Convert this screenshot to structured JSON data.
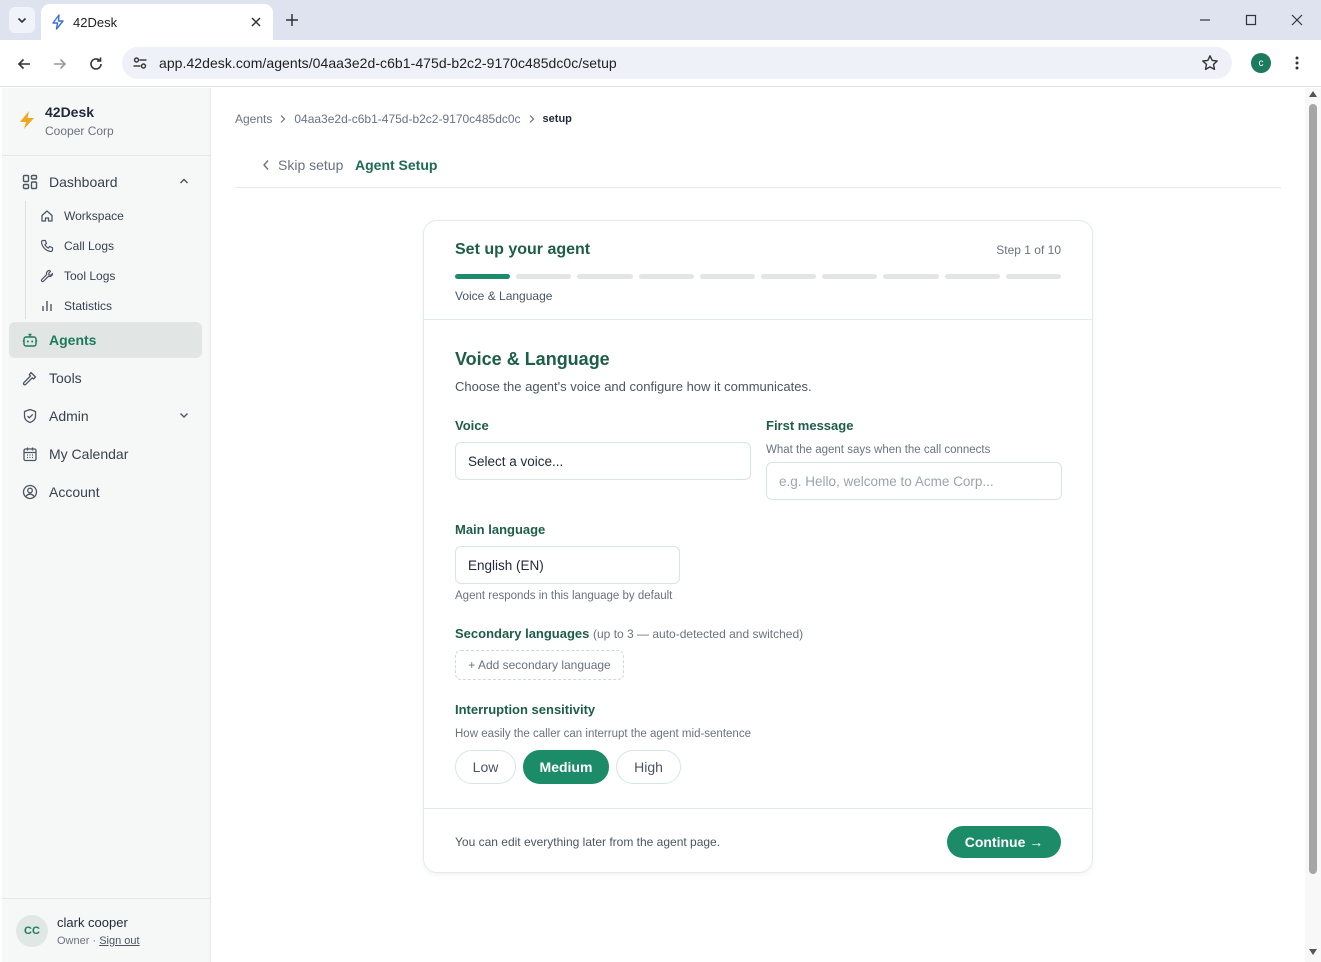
{
  "browser": {
    "tab_title": "42Desk",
    "url": "app.42desk.com/agents/04aa3e2d-c6b1-475d-b2c2-9170c485dc0c/setup",
    "profile_initial": "c"
  },
  "sidebar": {
    "brand": {
      "name": "42Desk",
      "org": "Cooper Corp"
    },
    "items": [
      {
        "label": "Dashboard",
        "icon": "dashboard-icon"
      },
      {
        "label": "Agents",
        "icon": "bot-icon",
        "active": true
      },
      {
        "label": "Tools",
        "icon": "hammer-icon"
      },
      {
        "label": "Admin",
        "icon": "shield-icon"
      },
      {
        "label": "My Calendar",
        "icon": "calendar-icon"
      },
      {
        "label": "Account",
        "icon": "user-circle-icon"
      }
    ],
    "dashboard_sub": [
      {
        "label": "Workspace",
        "icon": "home-icon"
      },
      {
        "label": "Call Logs",
        "icon": "phone-icon"
      },
      {
        "label": "Tool Logs",
        "icon": "wrench-icon"
      },
      {
        "label": "Statistics",
        "icon": "bar-chart-icon"
      }
    ],
    "user": {
      "initials": "CC",
      "name": "clark cooper",
      "role": "Owner",
      "sep": " · ",
      "signout": "Sign out"
    }
  },
  "breadcrumb": [
    "Agents",
    "04aa3e2d-c6b1-475d-b2c2-9170c485dc0c",
    "setup"
  ],
  "header": {
    "skip": "Skip setup",
    "title": "Agent Setup"
  },
  "card": {
    "heading": "Set up your agent",
    "step_text": "Step 1 of 10",
    "step_current": 1,
    "step_total": 10,
    "step_name": "Voice & Language",
    "section_title": "Voice & Language",
    "section_desc": "Choose the agent's voice and configure how it communicates.",
    "voice": {
      "label": "Voice",
      "value": "Select a voice..."
    },
    "first_message": {
      "label": "First message",
      "hint": "What the agent says when the call connects",
      "placeholder": "e.g. Hello, welcome to Acme Corp..."
    },
    "main_language": {
      "label": "Main language",
      "value": "English (EN)",
      "hint": "Agent responds in this language by default"
    },
    "secondary": {
      "label": "Secondary languages",
      "note": "(up to 3 — auto-detected and switched)",
      "add": "+ Add secondary language"
    },
    "interruption": {
      "label": "Interruption sensitivity",
      "hint": "How easily the caller can interrupt the agent mid-sentence",
      "options": [
        "Low",
        "Medium",
        "High"
      ],
      "selected": "Medium"
    },
    "footer_note": "You can edit everything later from the agent page.",
    "continue": "Continue →"
  },
  "colors": {
    "accent": "#1b8c67",
    "heading": "#1d5e49"
  }
}
